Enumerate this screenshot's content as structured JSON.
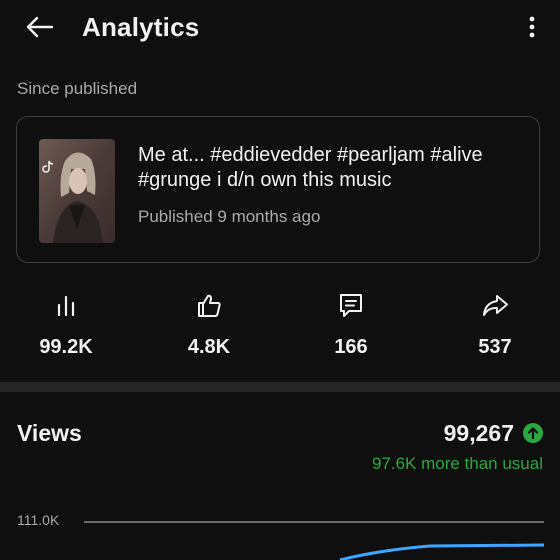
{
  "header": {
    "title": "Analytics",
    "back_icon": "arrow-left-icon",
    "more_icon": "more-vert-icon"
  },
  "section_label": "Since published",
  "video": {
    "title": "Me at... #eddievedder #pearljam #alive #grunge i d/n own this music",
    "published": "Published 9 months ago",
    "thumbnail_icon": "tiktok-logo-icon"
  },
  "stats": [
    {
      "icon": "views-bars-icon",
      "value": "99.2K"
    },
    {
      "icon": "thumbs-up-icon",
      "value": "4.8K"
    },
    {
      "icon": "comment-icon",
      "value": "166"
    },
    {
      "icon": "share-icon",
      "value": "537"
    }
  ],
  "views": {
    "label": "Views",
    "value": "99,267",
    "comparison": "97.6K more than usual",
    "trend_icon": "arrow-up-icon"
  },
  "chart": {
    "y_max_label": "111.0K"
  },
  "colors": {
    "background": "#0f0f0f",
    "positive": "#2ba640",
    "chart_line": "#3ea6ff"
  }
}
